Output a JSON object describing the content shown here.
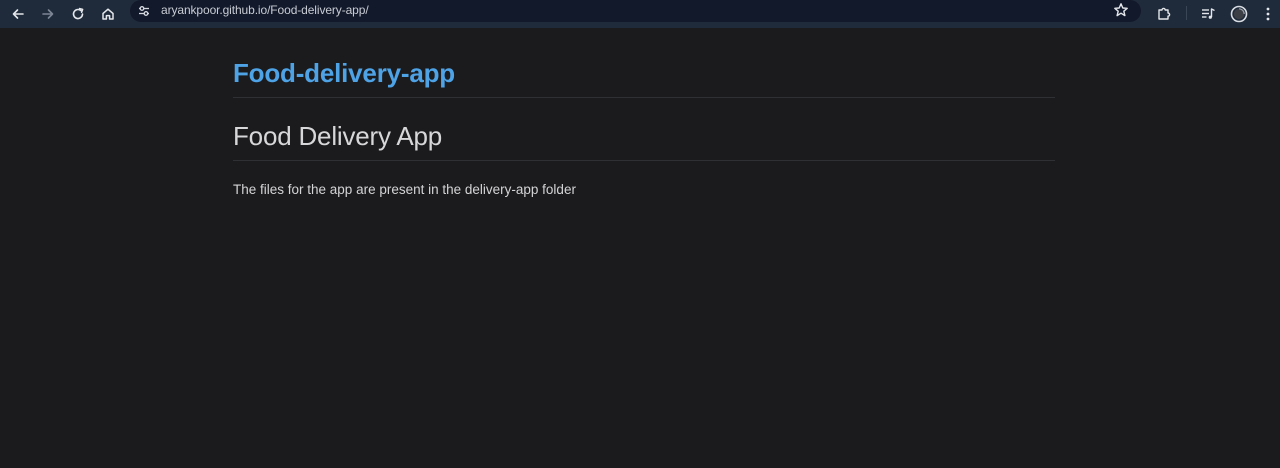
{
  "browser": {
    "url": "aryankpoor.github.io/Food-delivery-app/",
    "icons": {
      "back": "back-arrow-icon",
      "forward": "forward-arrow-icon",
      "reload": "reload-icon",
      "home": "home-icon",
      "site_info": "site-info-icon",
      "bookmark": "star-icon",
      "extensions": "puzzle-icon",
      "media": "media-queue-icon",
      "profile": "profile-icon",
      "menu": "kebab-menu-icon"
    },
    "colors": {
      "toolbar": "#1f2b3b",
      "omnibox": "#12192a"
    }
  },
  "page": {
    "site_title": "Food-delivery-app",
    "heading": "Food Delivery App",
    "paragraph": "The files for the app are present in the delivery-app folder",
    "colors": {
      "background": "#1b1b1d",
      "link": "#4ea2e6",
      "text": "#d4d4d6"
    }
  }
}
